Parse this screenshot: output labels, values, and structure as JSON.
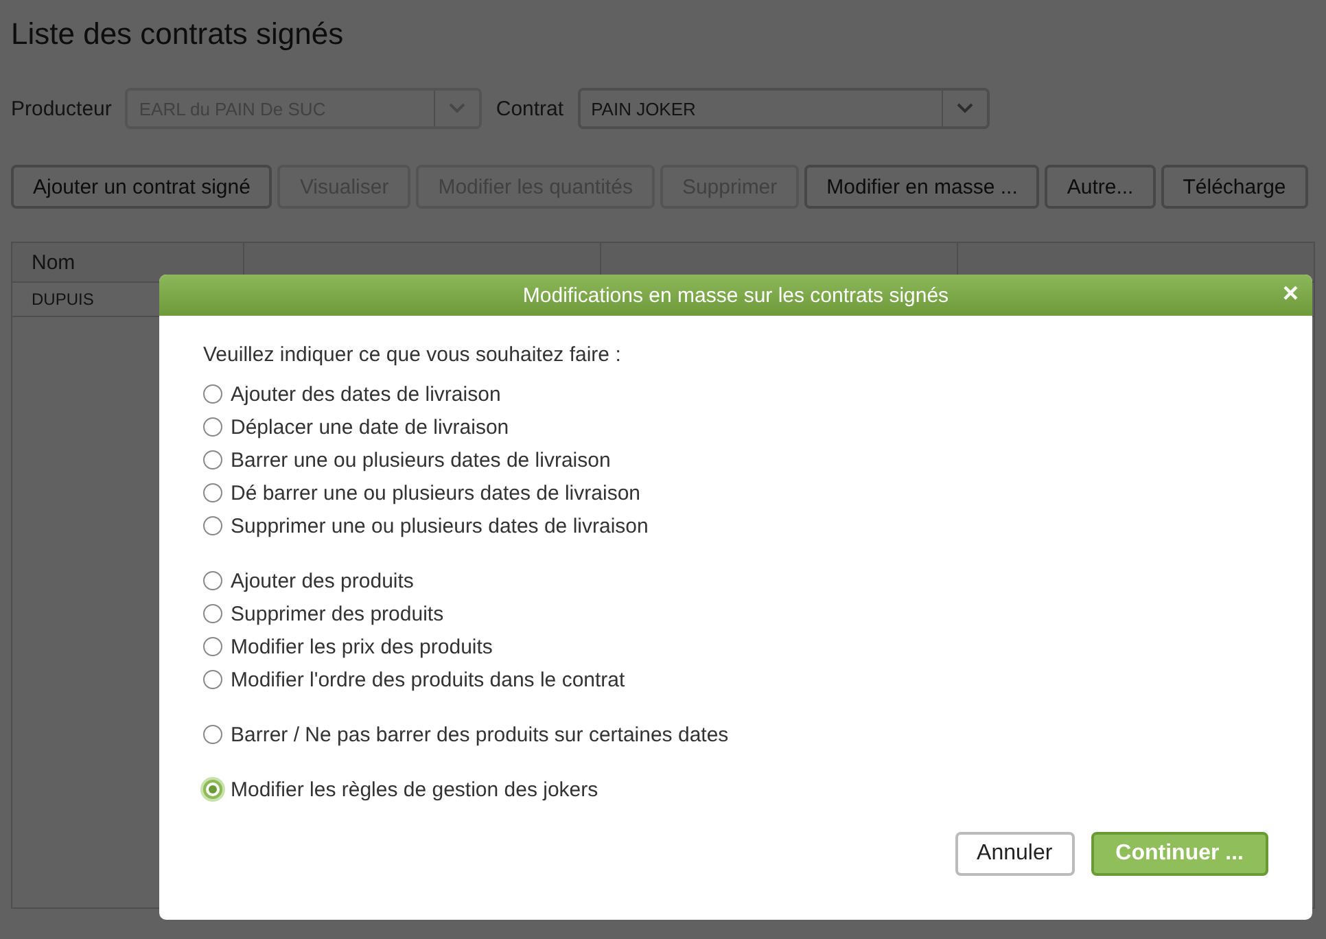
{
  "page": {
    "title": "Liste des contrats signés"
  },
  "filters": [
    {
      "label": "Producteur",
      "value": "EARL du PAIN De SUC",
      "disabled": true
    },
    {
      "label": "Contrat",
      "value": "PAIN JOKER",
      "disabled": false
    }
  ],
  "toolbar": [
    {
      "label": "Ajouter un contrat signé",
      "disabled": false
    },
    {
      "label": "Visualiser",
      "disabled": true
    },
    {
      "label": "Modifier les quantités",
      "disabled": true
    },
    {
      "label": "Supprimer",
      "disabled": true
    },
    {
      "label": "Modifier en masse ...",
      "disabled": false
    },
    {
      "label": "Autre...",
      "disabled": false
    },
    {
      "label": "Télécharge",
      "disabled": false
    }
  ],
  "table": {
    "columns": [
      "Nom"
    ],
    "rows": [
      [
        "DUPUIS"
      ]
    ]
  },
  "dialog": {
    "title": "Modifications en masse sur les contrats signés",
    "close": "×",
    "prompt": "Veuillez indiquer ce que vous souhaitez faire :",
    "groups": [
      [
        {
          "label": "Ajouter des dates de livraison",
          "selected": false
        },
        {
          "label": "Déplacer une date de livraison",
          "selected": false
        },
        {
          "label": "Barrer une ou plusieurs dates de livraison",
          "selected": false
        },
        {
          "label": "Dé barrer une ou plusieurs dates de livraison",
          "selected": false
        },
        {
          "label": "Supprimer une ou plusieurs dates de livraison",
          "selected": false
        }
      ],
      [
        {
          "label": "Ajouter des produits",
          "selected": false
        },
        {
          "label": "Supprimer des produits",
          "selected": false
        },
        {
          "label": "Modifier les prix des produits",
          "selected": false
        },
        {
          "label": "Modifier l'ordre des produits dans le contrat",
          "selected": false
        }
      ],
      [
        {
          "label": "Barrer / Ne pas barrer des produits sur certaines dates",
          "selected": false
        }
      ],
      [
        {
          "label": "Modifier les règles de gestion des jokers",
          "selected": true
        }
      ]
    ],
    "buttons": [
      {
        "label": "Annuler",
        "kind": "secondary"
      },
      {
        "label": "Continuer ...",
        "kind": "primary"
      }
    ]
  }
}
